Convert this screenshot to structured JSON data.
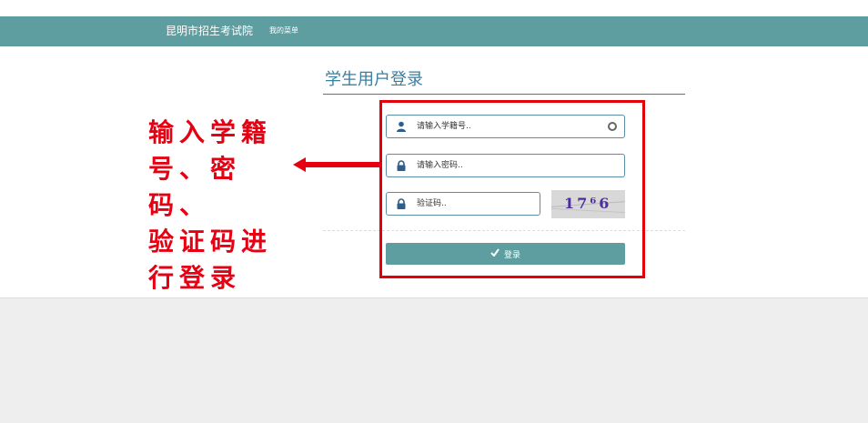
{
  "navbar": {
    "brand": "昆明市招生考试院",
    "menu": "我的菜单",
    "color": "#5f9ea0"
  },
  "login": {
    "title": "学生用户登录",
    "student_id": {
      "placeholder": "请输入学籍号..",
      "icon": "user-icon",
      "trailing_icon": "circle-icon"
    },
    "password": {
      "placeholder": "请输入密码..",
      "icon": "lock-icon"
    },
    "captcha": {
      "placeholder": "验证码..",
      "icon": "lock-icon",
      "image_text": "17⁶6"
    },
    "submit_label": "登录",
    "submit_icon": "check-icon"
  },
  "annotation": {
    "lines": [
      "输入学籍",
      "号、密码、",
      "验证码进",
      "行登录"
    ],
    "color": "#e60012"
  }
}
